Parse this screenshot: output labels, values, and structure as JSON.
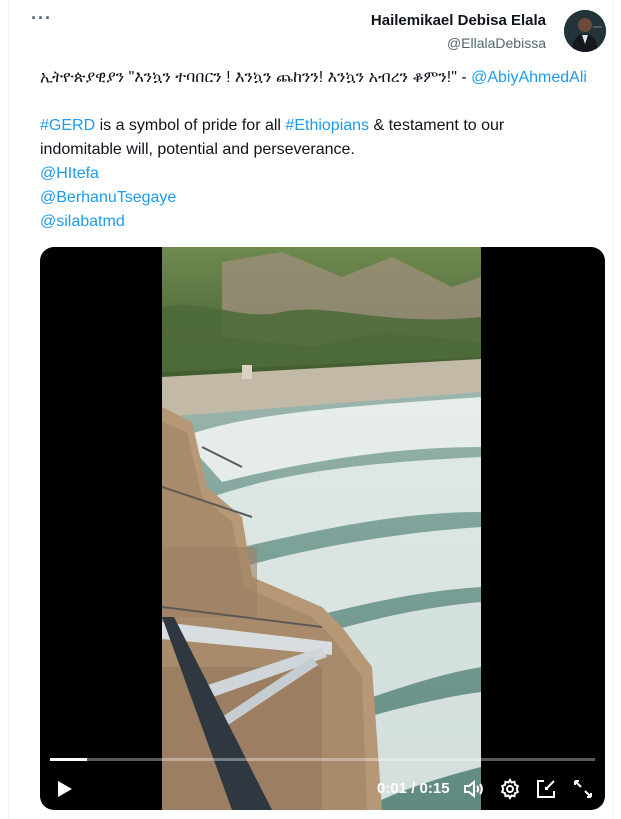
{
  "header": {
    "more_label": "···",
    "author_name": "Hailemikael Debisa Elala",
    "author_handle": "@EllalaDebissa"
  },
  "tweet": {
    "line1_text": "ኢትዮጵያዊያን \"እንኳን ተባበርን ! እንኳን ጨከንን! እንኳን አብረን ቆምን!\" - ",
    "line1_mention": "@AbiyAhmedAli",
    "hashtag_gerd": "#GERD",
    "body_part1": " is a symbol of pride for all ",
    "hashtag_ethiopians": "#Ethiopians",
    "body_part2": " & testament to our",
    "body_line2": "indomitable will, potential and perseverance.",
    "mentions": [
      "@HItefa",
      "@BerhanuTsegaye",
      "@silabatmd"
    ]
  },
  "video": {
    "time_display": "0:01 / 0:15",
    "progress": 0.067,
    "icons": {
      "play": "play-icon",
      "volume": "volume-icon",
      "settings": "gear-icon",
      "popout": "popout-icon",
      "fullscreen": "fullscreen-icon"
    }
  },
  "colors": {
    "link": "#1d9bf0",
    "handle": "#536471",
    "text": "#0f1419"
  }
}
